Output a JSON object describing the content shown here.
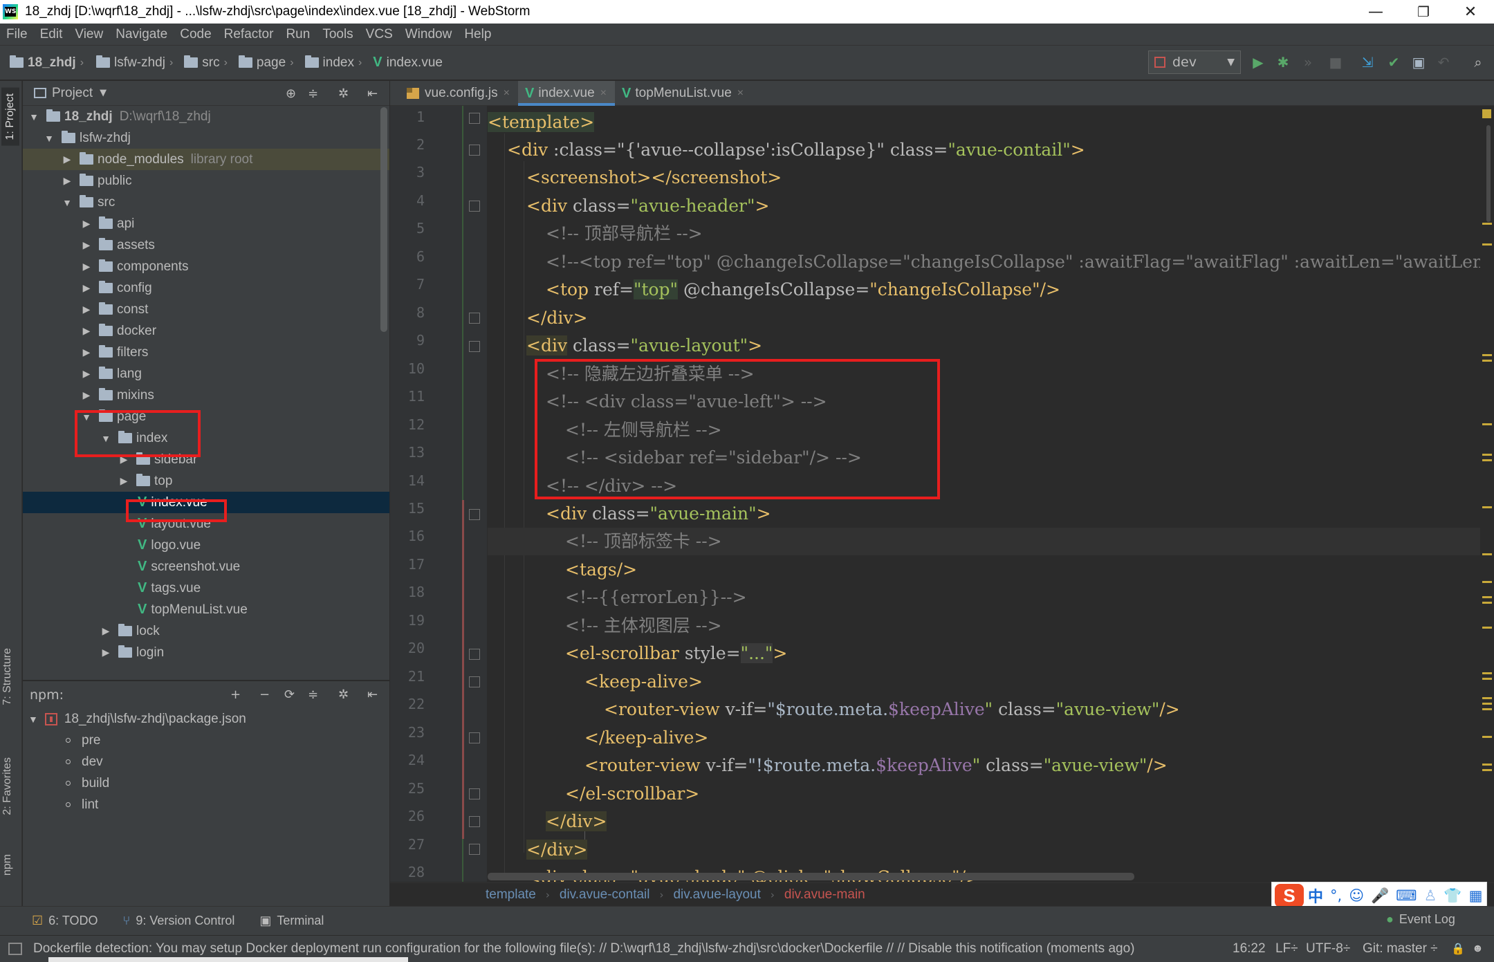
{
  "window": {
    "title": "18_zhdj [D:\\wqrf\\18_zhdj] - ...\\lsfw-zhdj\\src\\page\\index\\index.vue [18_zhdj] - WebStorm",
    "minimize": "—",
    "restore": "❐",
    "close": "✕"
  },
  "menu": [
    "File",
    "Edit",
    "View",
    "Navigate",
    "Code",
    "Refactor",
    "Run",
    "Tools",
    "VCS",
    "Window",
    "Help"
  ],
  "nav": {
    "crumbs": [
      "18_zhdj",
      "lsfw-zhdj",
      "src",
      "page",
      "index",
      "index.vue"
    ],
    "run_config": "dev"
  },
  "left_strip": {
    "project": "1: Project",
    "structure": "7: Structure",
    "favorites": "2: Favorites",
    "npm": "npm"
  },
  "project_panel": {
    "title": "Project",
    "tree": [
      {
        "label": "18_zhdj",
        "muted": "D:\\wqrf\\18_zhdj",
        "type": "folder",
        "expanded": true
      },
      {
        "label": "lsfw-zhdj",
        "muted": "",
        "type": "folder",
        "expanded": true
      },
      {
        "label": "node_modules",
        "muted": "library root",
        "type": "folder",
        "expanded": false
      },
      {
        "label": "public",
        "muted": "",
        "type": "folder",
        "expanded": false
      },
      {
        "label": "src",
        "muted": "",
        "type": "folder",
        "expanded": true
      },
      {
        "label": "api",
        "muted": "",
        "type": "folder",
        "expanded": false
      },
      {
        "label": "assets",
        "muted": "",
        "type": "folder",
        "expanded": false
      },
      {
        "label": "components",
        "muted": "",
        "type": "folder",
        "expanded": false
      },
      {
        "label": "config",
        "muted": "",
        "type": "folder",
        "expanded": false
      },
      {
        "label": "const",
        "muted": "",
        "type": "folder",
        "expanded": false
      },
      {
        "label": "docker",
        "muted": "",
        "type": "folder",
        "expanded": false
      },
      {
        "label": "filters",
        "muted": "",
        "type": "folder",
        "expanded": false
      },
      {
        "label": "lang",
        "muted": "",
        "type": "folder",
        "expanded": false
      },
      {
        "label": "mixins",
        "muted": "",
        "type": "folder",
        "expanded": false
      },
      {
        "label": "page",
        "muted": "",
        "type": "folder",
        "expanded": true
      },
      {
        "label": "index",
        "muted": "",
        "type": "folder",
        "expanded": true
      },
      {
        "label": "sidebar",
        "muted": "",
        "type": "folder",
        "expanded": false
      },
      {
        "label": "top",
        "muted": "",
        "type": "folder",
        "expanded": false
      },
      {
        "label": "index.vue",
        "muted": "",
        "type": "vue",
        "selected": true
      },
      {
        "label": "layout.vue",
        "muted": "",
        "type": "vue"
      },
      {
        "label": "logo.vue",
        "muted": "",
        "type": "vue"
      },
      {
        "label": "screenshot.vue",
        "muted": "",
        "type": "vue"
      },
      {
        "label": "tags.vue",
        "muted": "",
        "type": "vue"
      },
      {
        "label": "topMenuList.vue",
        "muted": "",
        "type": "vue"
      },
      {
        "label": "lock",
        "muted": "",
        "type": "folder",
        "expanded": false
      },
      {
        "label": "login",
        "muted": "",
        "type": "folder",
        "expanded": false
      }
    ]
  },
  "npm_panel": {
    "title": "npm:",
    "package": "18_zhdj\\lsfw-zhdj\\package.json",
    "scripts": [
      "pre",
      "dev",
      "build",
      "lint"
    ]
  },
  "tabs": [
    {
      "label": "vue.config.js",
      "type": "js",
      "active": false
    },
    {
      "label": "index.vue",
      "type": "vue",
      "active": true
    },
    {
      "label": "topMenuList.vue",
      "type": "vue",
      "active": false
    }
  ],
  "editor": {
    "line_numbers": [
      "1",
      "2",
      "3",
      "4",
      "5",
      "6",
      "7",
      "8",
      "9",
      "10",
      "11",
      "12",
      "13",
      "14",
      "15",
      "16",
      "17",
      "18",
      "19",
      "20",
      "21",
      "22",
      "23",
      "24",
      "25",
      "26",
      "27",
      "28"
    ],
    "lines": {
      "l1": "<template>",
      "l2a": "<div",
      "l2b": " :class=\"{'avue--collapse':isCollapse}\" ",
      "l2c": "class=",
      "l2d": "\"avue-contail\"",
      "l2e": ">",
      "l3": "<screenshot></screenshot>",
      "l4a": "<div ",
      "l4b": "class=",
      "l4c": "\"avue-header\"",
      "l4d": ">",
      "l5": "<!-- 顶部导航栏 -->",
      "l6": "<!--<top ref=\"top\" @changeIsCollapse=\"changeIsCollapse\" :awaitFlag=\"awaitFlag\" :awaitLen=\"awaitLen\"/>-->",
      "l7a": "<top ",
      "l7b": "ref=",
      "l7c": "\"top\"",
      "l7d": " @changeIsCollapse=",
      "l7e": "\"changeIsCollapse\"",
      "l7f": "/>",
      "l8": "</div>",
      "l9a": "<div",
      "l9b": " class=",
      "l9c": "\"avue-layout\"",
      "l9d": ">",
      "l10": "<!-- 隐藏左边折叠菜单 -->",
      "l11": "<!-- <div class=\"avue-left\"> -->",
      "l12": "<!-- 左侧导航栏 -->",
      "l13": "<!-- <sidebar ref=\"sidebar\"/> -->",
      "l14": "<!-- </div> -->",
      "l15a": "<div ",
      "l15b": "class=",
      "l15c": "\"avue-main\"",
      "l15d": ">",
      "l16": "<!-- 顶部标签卡 -->",
      "l17": "<tags/>",
      "l18": "<!--{{errorLen}}-->",
      "l19": "<!-- 主体视图层 -->",
      "l20a": "<el-scrollbar ",
      "l20b": "style=",
      "l20c": "\"...\"",
      "l20d": ">",
      "l21": "<keep-alive>",
      "l22a": "<router-view ",
      "l22b": "v-if=",
      "l22c": "\"$route.meta.",
      "l22d": "$keepAlive",
      "l22e": "\" ",
      "l22f": "class=",
      "l22g": "\"avue-view\"",
      "l22h": "/>",
      "l23": "</keep-alive>",
      "l24a": "<router-view ",
      "l24b": "v-if=",
      "l24c": "\"!$route.meta.",
      "l24d": "$keepAlive",
      "l24e": "\" ",
      "l24f": "class=",
      "l24g": "\"avue-view\"",
      "l24h": "/>",
      "l25": "</el-scrollbar>",
      "l26": "</div>",
      "l27": "</div>",
      "l28": "<div class=\"avue-shade\" @click=\"showCollapse\"/>"
    }
  },
  "editor_breadcrumb": [
    "template",
    "div.avue-contail",
    "div.avue-layout",
    "div.avue-main"
  ],
  "tool_windows": [
    {
      "label": "6: TODO",
      "icon": "todo-icon"
    },
    {
      "label": "9: Version Control",
      "icon": "vcs-icon"
    },
    {
      "label": "Terminal",
      "icon": "terminal-icon"
    }
  ],
  "event_log": "Event Log",
  "status": {
    "message": "Dockerfile detection: You may setup Docker deployment run configuration for the following file(s): // D:\\wqrf\\18_zhdj\\lsfw-zhdj\\src\\docker\\Dockerfile // // Disable this notification (moments ago)",
    "position": "16:22",
    "line_sep": "LF÷",
    "encoding": "UTF-8÷",
    "git": "Git: master ÷"
  },
  "ime": {
    "logo": "S",
    "lang": "中"
  },
  "colors": {
    "annotation_red": "#e81e1e",
    "selection": "#0d293e",
    "vue_green": "#41b883",
    "tag": "#e8bf6a",
    "string": "#a5c25c",
    "comment": "#808080"
  }
}
